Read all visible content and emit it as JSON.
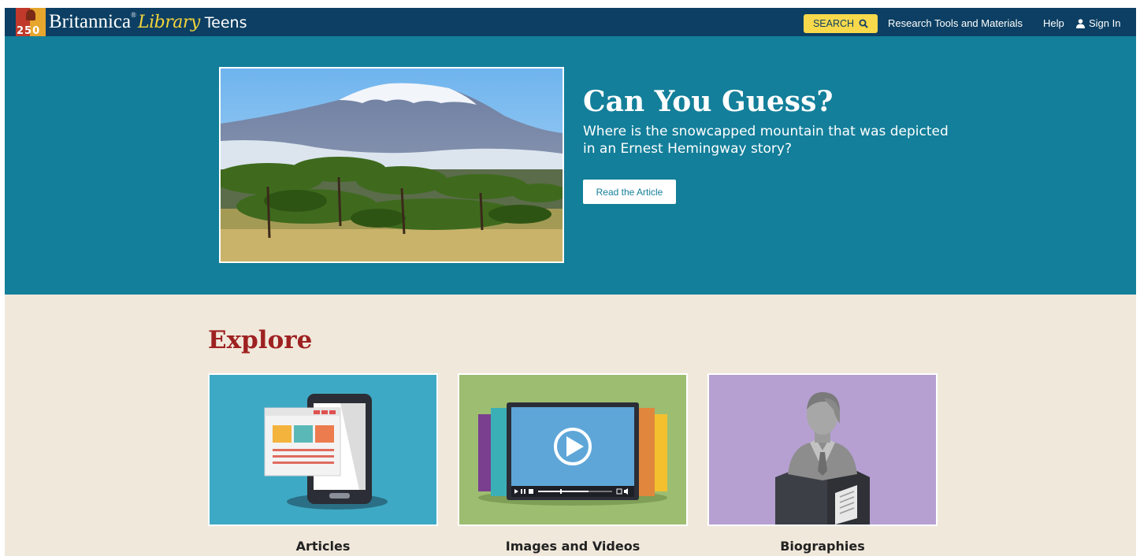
{
  "header": {
    "logo_number": "250",
    "brand_name": "Britannica",
    "brand_reg": "®",
    "brand_library": "Library",
    "brand_edition": "Teens",
    "search_label": "SEARCH",
    "research_link": "Research Tools and Materials",
    "help_link": "Help",
    "signin_link": "Sign In",
    "icons": [
      "search-icon",
      "user-icon"
    ]
  },
  "hero": {
    "title": "Can You Guess?",
    "subtitle": "Where is the snowcapped mountain that was depicted in an Ernest Hemingway story?",
    "button_label": "Read the Article"
  },
  "explore": {
    "title": "Explore",
    "cards": [
      {
        "label": "Articles",
        "icon": "tablet-article-icon"
      },
      {
        "label": "Images and Videos",
        "icon": "video-player-icon"
      },
      {
        "label": "Biographies",
        "icon": "bust-statue-icon"
      }
    ]
  },
  "colors": {
    "header_bg": "#0c3f63",
    "hero_bg": "#137f9a",
    "page_bg": "#f0e8db",
    "search_btn": "#f8d94b",
    "explore_title": "#9e2121",
    "card_articles": "#3ea9c4",
    "card_images": "#9dbd71",
    "card_bio": "#b6a0d2"
  }
}
